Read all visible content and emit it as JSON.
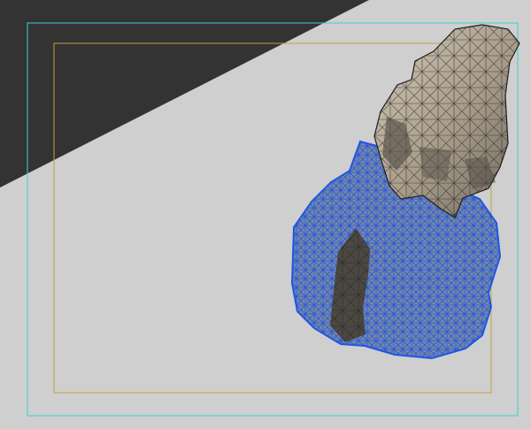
{
  "viewport": {
    "colors": {
      "background": "#cfcfcf",
      "dark_panel": "#333333",
      "safe_frame_outer": "#38d0cf",
      "safe_frame_inner": "#c2a23e",
      "wire_blue": "#1f56e6",
      "rock_fill": "#b6ab97",
      "rock_shadow": "#5b544c",
      "rock_wire": "#1e1e1e"
    },
    "icons": {
      "camera_frame": "safe-frame-icon"
    }
  }
}
